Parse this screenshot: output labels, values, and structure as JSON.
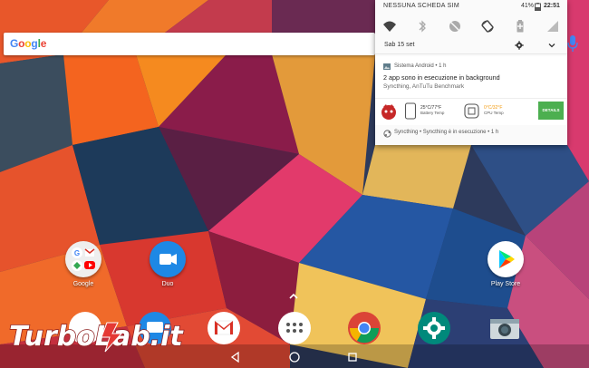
{
  "search": {
    "logo_text": "Google"
  },
  "shade": {
    "carrier": "NESSUNA SCHEDA SIM",
    "battery_pct": "41%",
    "time": "22:51",
    "date": "Sab 15 set"
  },
  "notification": {
    "header": "Sistema Android • 1 h",
    "title": "2 app sono in esecuzione in background",
    "subtitle": "Syncthing, AnTuTu Benchmark",
    "battery_temp_value": "25°C/77°F",
    "battery_temp_label": "Battery Temp",
    "cpu_temp_value": "0°C/32°F",
    "cpu_temp_label": "CPU Temp",
    "details_label": "DETAILS"
  },
  "sync": {
    "text": "Syncthing • Syncthing è in esecuzione • 1 h"
  },
  "home_apps": [
    {
      "label": "Google"
    },
    {
      "label": "Duo"
    },
    {
      "label": "Play Store"
    }
  ],
  "colors": {
    "details_green": "#4caf50",
    "duo_blue": "#1e88e5",
    "gmail_red": "#d93025",
    "settings_teal": "#00897b"
  }
}
